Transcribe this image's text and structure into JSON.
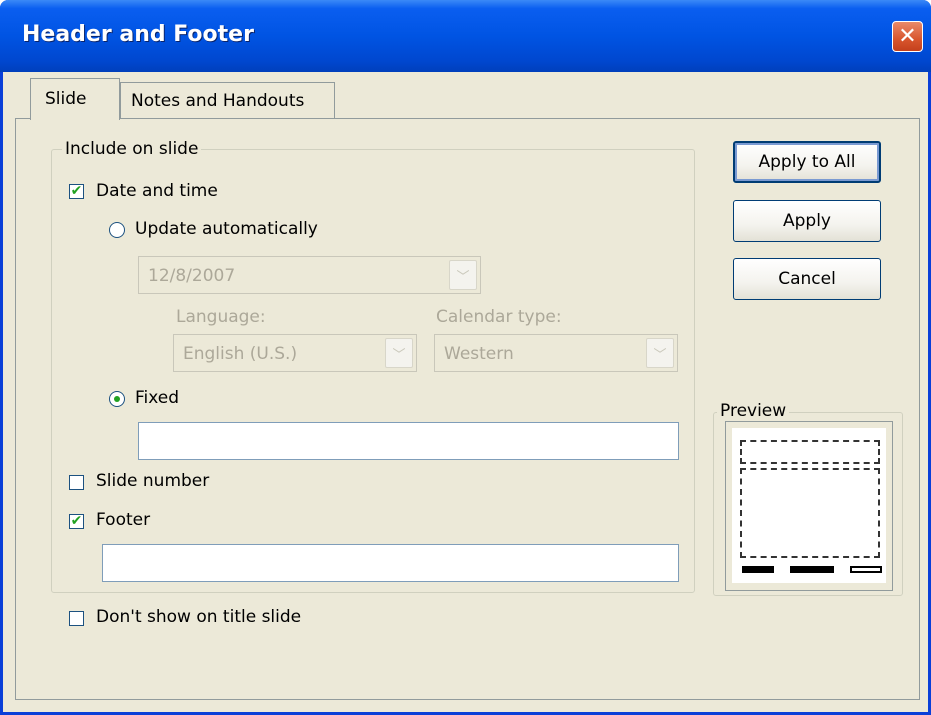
{
  "window": {
    "title": "Header and Footer",
    "close_glyph": "✕"
  },
  "tabs": [
    {
      "label": "Slide",
      "active": true
    },
    {
      "label": "Notes and Handouts",
      "active": false
    }
  ],
  "include_group": {
    "caption": "Include on slide",
    "date_time": {
      "label": "Date and time",
      "checked": true
    },
    "update_auto": {
      "label": "Update automatically",
      "selected": false,
      "date_value": "12/8/2007",
      "language_label": "Language:",
      "language_value": "English (U.S.)",
      "calendar_label": "Calendar type:",
      "calendar_value": "Western"
    },
    "fixed": {
      "label": "Fixed",
      "selected": true,
      "value": ""
    },
    "slide_number": {
      "label": "Slide number",
      "checked": false
    },
    "footer": {
      "label": "Footer",
      "checked": true,
      "value": ""
    }
  },
  "dont_show_title": {
    "label": "Don't show on title slide",
    "checked": false
  },
  "buttons": {
    "apply_all": "Apply to All",
    "apply": "Apply",
    "cancel": "Cancel"
  },
  "preview": {
    "caption": "Preview"
  },
  "icons": {
    "check": "✔",
    "dropdown_arrow": "﹀"
  },
  "colors": {
    "titlebar": "#0054e3",
    "dialog_bg": "#ece9d8",
    "check_green": "#21a121",
    "close_red": "#d8552d"
  }
}
